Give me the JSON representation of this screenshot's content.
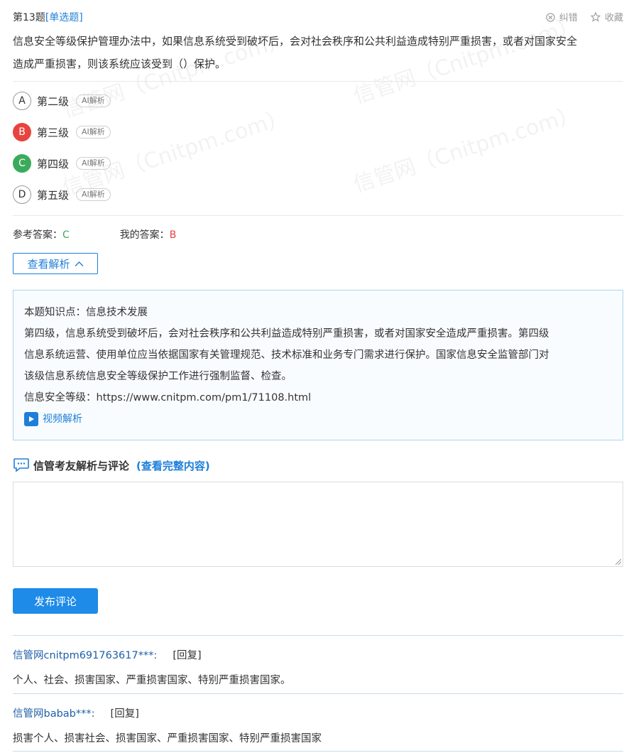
{
  "question": {
    "number": "第13题",
    "type": "[单选题]",
    "report_label": "纠错",
    "favorite_label": "收藏",
    "text_line1": "信息安全等级保护管理办法中，如果信息系统受到破坏后，会对社会秩序和公共利益造成特别严重损害，或者对国家安全",
    "text_line2": "造成严重损害，则该系统应该受到（）保护。"
  },
  "options": [
    {
      "letter": "A",
      "text": "第二级",
      "ai": "AI解析",
      "state": "normal"
    },
    {
      "letter": "B",
      "text": "第三级",
      "ai": "AI解析",
      "state": "wrong"
    },
    {
      "letter": "C",
      "text": "第四级",
      "ai": "AI解析",
      "state": "right"
    },
    {
      "letter": "D",
      "text": "第五级",
      "ai": "AI解析",
      "state": "normal"
    }
  ],
  "answers": {
    "ref_label": "参考答案：",
    "ref_value": "C",
    "mine_label": "我的答案：",
    "mine_value": "B"
  },
  "view_analysis_label": "查看解析",
  "analysis": {
    "knowledge": "本题知识点：信息技术发展",
    "line1": "第四级，信息系统受到破坏后，会对社会秩序和公共利益造成特别严重损害，或者对国家安全造成严重损害。第四级",
    "line2": "信息系统运营、使用单位应当依据国家有关管理规范、技术标准和业务专门需求进行保护。国家信息安全监管部门对",
    "line3": "该级信息系统信息安全等级保护工作进行强制监督、检查。",
    "link": "信息安全等级：https://www.cnitpm.com/pm1/71108.html",
    "video_label": "视频解析"
  },
  "comments_section": {
    "title": "信管考友解析与评论",
    "full_link": "(查看完整内容)",
    "post_label": "发布评论"
  },
  "comments": [
    {
      "user": "信管网cnitpm691763617***:",
      "reply": "[回复]",
      "body": "个人、社会、损害国家、严重损害国家、特别严重损害国家。"
    },
    {
      "user": "信管网babab***:",
      "reply": "[回复]",
      "body": "损害个人、损害社会、损害国家、严重损害国家、特别严重损害国家"
    }
  ],
  "watermark": "信管网（Cnitpm.com）",
  "colors": {
    "accent": "#1e7fd8",
    "wrong": "#e8443f",
    "right": "#3bab5b"
  }
}
